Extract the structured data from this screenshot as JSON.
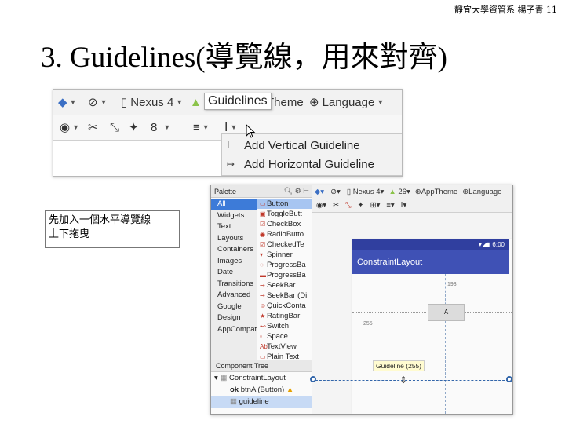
{
  "header": {
    "text": "靜宜大學資管系 楊子青 11"
  },
  "title": "3. Guidelines(導覽線，用來對齊)",
  "toolbar_shot": {
    "row1": {
      "device": "Nexus 4",
      "theme": "Theme",
      "language": "Language"
    },
    "tooltip": "Guidelines",
    "row2": {
      "zoom": "8"
    },
    "menu": [
      "Add Vertical Guideline",
      "Add Horizontal Guideline"
    ]
  },
  "caption": [
    "先加入一個水平導覽線",
    "上下拖曳"
  ],
  "editor_shot": {
    "palette_title": "Palette",
    "categories": [
      "All",
      "Widgets",
      "Text",
      "Layouts",
      "Containers",
      "Images",
      "Date",
      "Transitions",
      "Advanced",
      "Google",
      "Design",
      "AppCompat"
    ],
    "widgets": [
      "Button",
      "ToggleButt",
      "CheckBox",
      "RadioButto",
      "CheckedTe",
      "Spinner",
      "ProgressBa",
      "ProgressBa",
      "SeekBar",
      "SeekBar (Di",
      "QuickConta",
      "RatingBar",
      "Switch",
      "Space",
      "TextView",
      "Plain Text"
    ],
    "component_tree_title": "Component Tree",
    "tree": [
      "ConstraintLayout",
      "btnA (Button)",
      "guideline"
    ],
    "editor_toolbar1": {
      "device": "Nexus 4",
      "api": "26",
      "theme": "AppTheme",
      "language": "Language"
    },
    "status_time": "6:00",
    "app_title": "ConstraintLayout",
    "button_text": "A",
    "margin_top": "193",
    "margin_left": "255",
    "guideline_tooltip": "Guideline (255)"
  },
  "colors": {
    "appbar": "#3f51b5",
    "statusbar": "#303f9f",
    "selection": "#3d7bd8"
  }
}
